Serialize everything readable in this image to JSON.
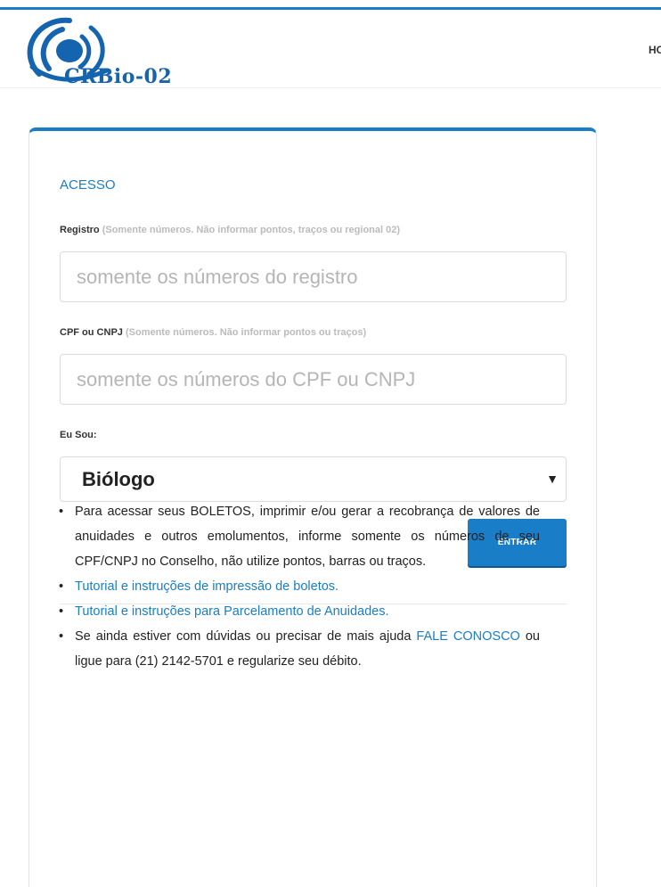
{
  "header": {
    "logo_text": "CRBio-02",
    "nav_item": "HOME"
  },
  "form": {
    "title": "ACESSO",
    "registro": {
      "label": "Registro",
      "hint": "(Somente números. Não informar pontos, traços ou regional 02)",
      "placeholder": "somente os números do registro",
      "value": ""
    },
    "cpf": {
      "label": "CPF ou CNPJ",
      "hint": "(Somente números. Não informar pontos ou traços)",
      "placeholder": "somente os números do CPF ou CNPJ",
      "value": ""
    },
    "eu_sou": {
      "label": "Eu Sou:",
      "selected": "Biólogo"
    },
    "submit_label": "ENTRAR"
  },
  "info": {
    "item1": "Para acessar seus BOLETOS, imprimir e/ou gerar a recobrança de valores de anuidades e outros emolumentos, informe somente os números de seu CPF/CNPJ no Conselho, não utilize pontos, barras ou traços.",
    "item2_link": "Tutorial e instruções de impressão de boletos.",
    "item3_link": "Tutorial e instruções para Parcelamento de Anuidades.",
    "item4_prefix": "Se ainda estiver com dúvidas ou precisar de mais ajuda ",
    "item4_link": "FALE CONOSCO",
    "item4_suffix": " ou ligue para (21) 2142-5701 e regularize seu débito."
  },
  "colors": {
    "accent": "#1a7dc7",
    "logo": "#1564b0"
  }
}
